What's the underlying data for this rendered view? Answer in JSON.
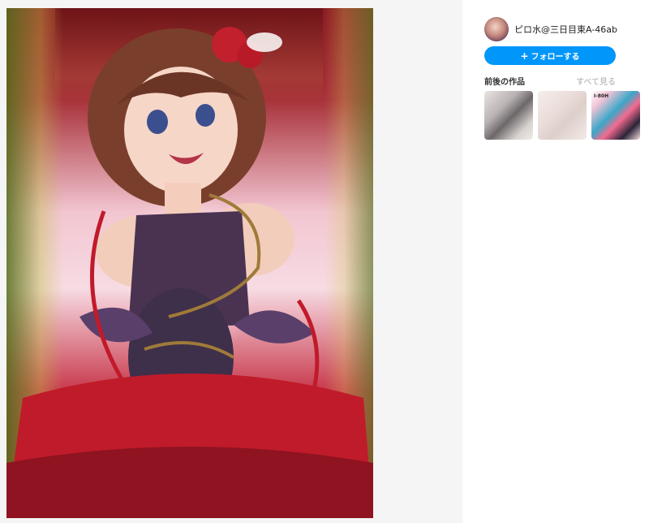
{
  "author": {
    "name": "ピロ水@三日目東A-46ab"
  },
  "follow_button": {
    "label": "フォローする",
    "icon": "plus-icon"
  },
  "works": {
    "title": "前後の作品",
    "see_all": "すべて見る",
    "thumbnails": [
      {
        "label": ""
      },
      {
        "label": ""
      },
      {
        "label": "I-80H"
      }
    ]
  },
  "colors": {
    "accent": "#0096fa",
    "background": "#f5f5f5"
  }
}
